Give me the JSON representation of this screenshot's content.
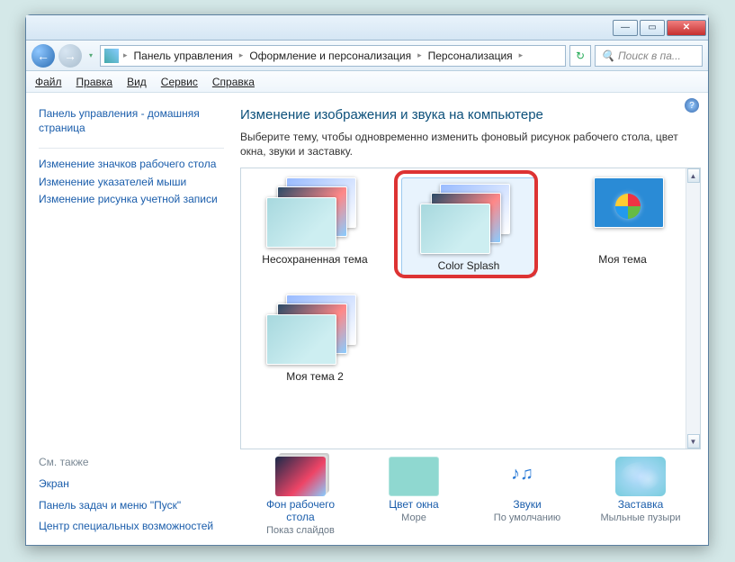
{
  "titlebar": {
    "min": "—",
    "max": "▭",
    "close": "✕"
  },
  "nav": {
    "back": "←",
    "fwd": "→",
    "drop": "▾",
    "crumbs": [
      "Панель управления",
      "Оформление и персонализация",
      "Персонализация"
    ],
    "sep": "▸",
    "refresh": "↻",
    "search_placeholder": "Поиск в па..."
  },
  "menu": {
    "file": "Файл",
    "edit": "Правка",
    "view": "Вид",
    "tools": "Сервис",
    "help": "Справка"
  },
  "sidebar": {
    "home": "Панель управления - домашняя страница",
    "links": [
      "Изменение значков рабочего стола",
      "Изменение указателей мыши",
      "Изменение рисунка учетной записи"
    ],
    "seealso": "См. также",
    "seealso_links": [
      "Экран",
      "Панель задач и меню \"Пуск\"",
      "Центр специальных возможностей"
    ]
  },
  "main": {
    "help": "?",
    "title": "Изменение изображения и звука на компьютере",
    "desc": "Выберите тему, чтобы одновременно изменить фоновый рисунок рабочего стола, цвет окна, звуки и заставку.",
    "themes": [
      {
        "label": "Несохраненная тема"
      },
      {
        "label": "Color Splash",
        "selected": true
      },
      {
        "label": "Моя тема",
        "win7": true
      },
      {
        "label": "Моя тема 2"
      }
    ],
    "bottom": [
      {
        "name": "Фон рабочего стола",
        "value": "Показ слайдов",
        "kind": "bg"
      },
      {
        "name": "Цвет окна",
        "value": "Море",
        "kind": "color"
      },
      {
        "name": "Звуки",
        "value": "По умолчанию",
        "kind": "sound"
      },
      {
        "name": "Заставка",
        "value": "Мыльные пузыри",
        "kind": "saver"
      }
    ],
    "scroll_up": "▲",
    "scroll_down": "▼"
  }
}
